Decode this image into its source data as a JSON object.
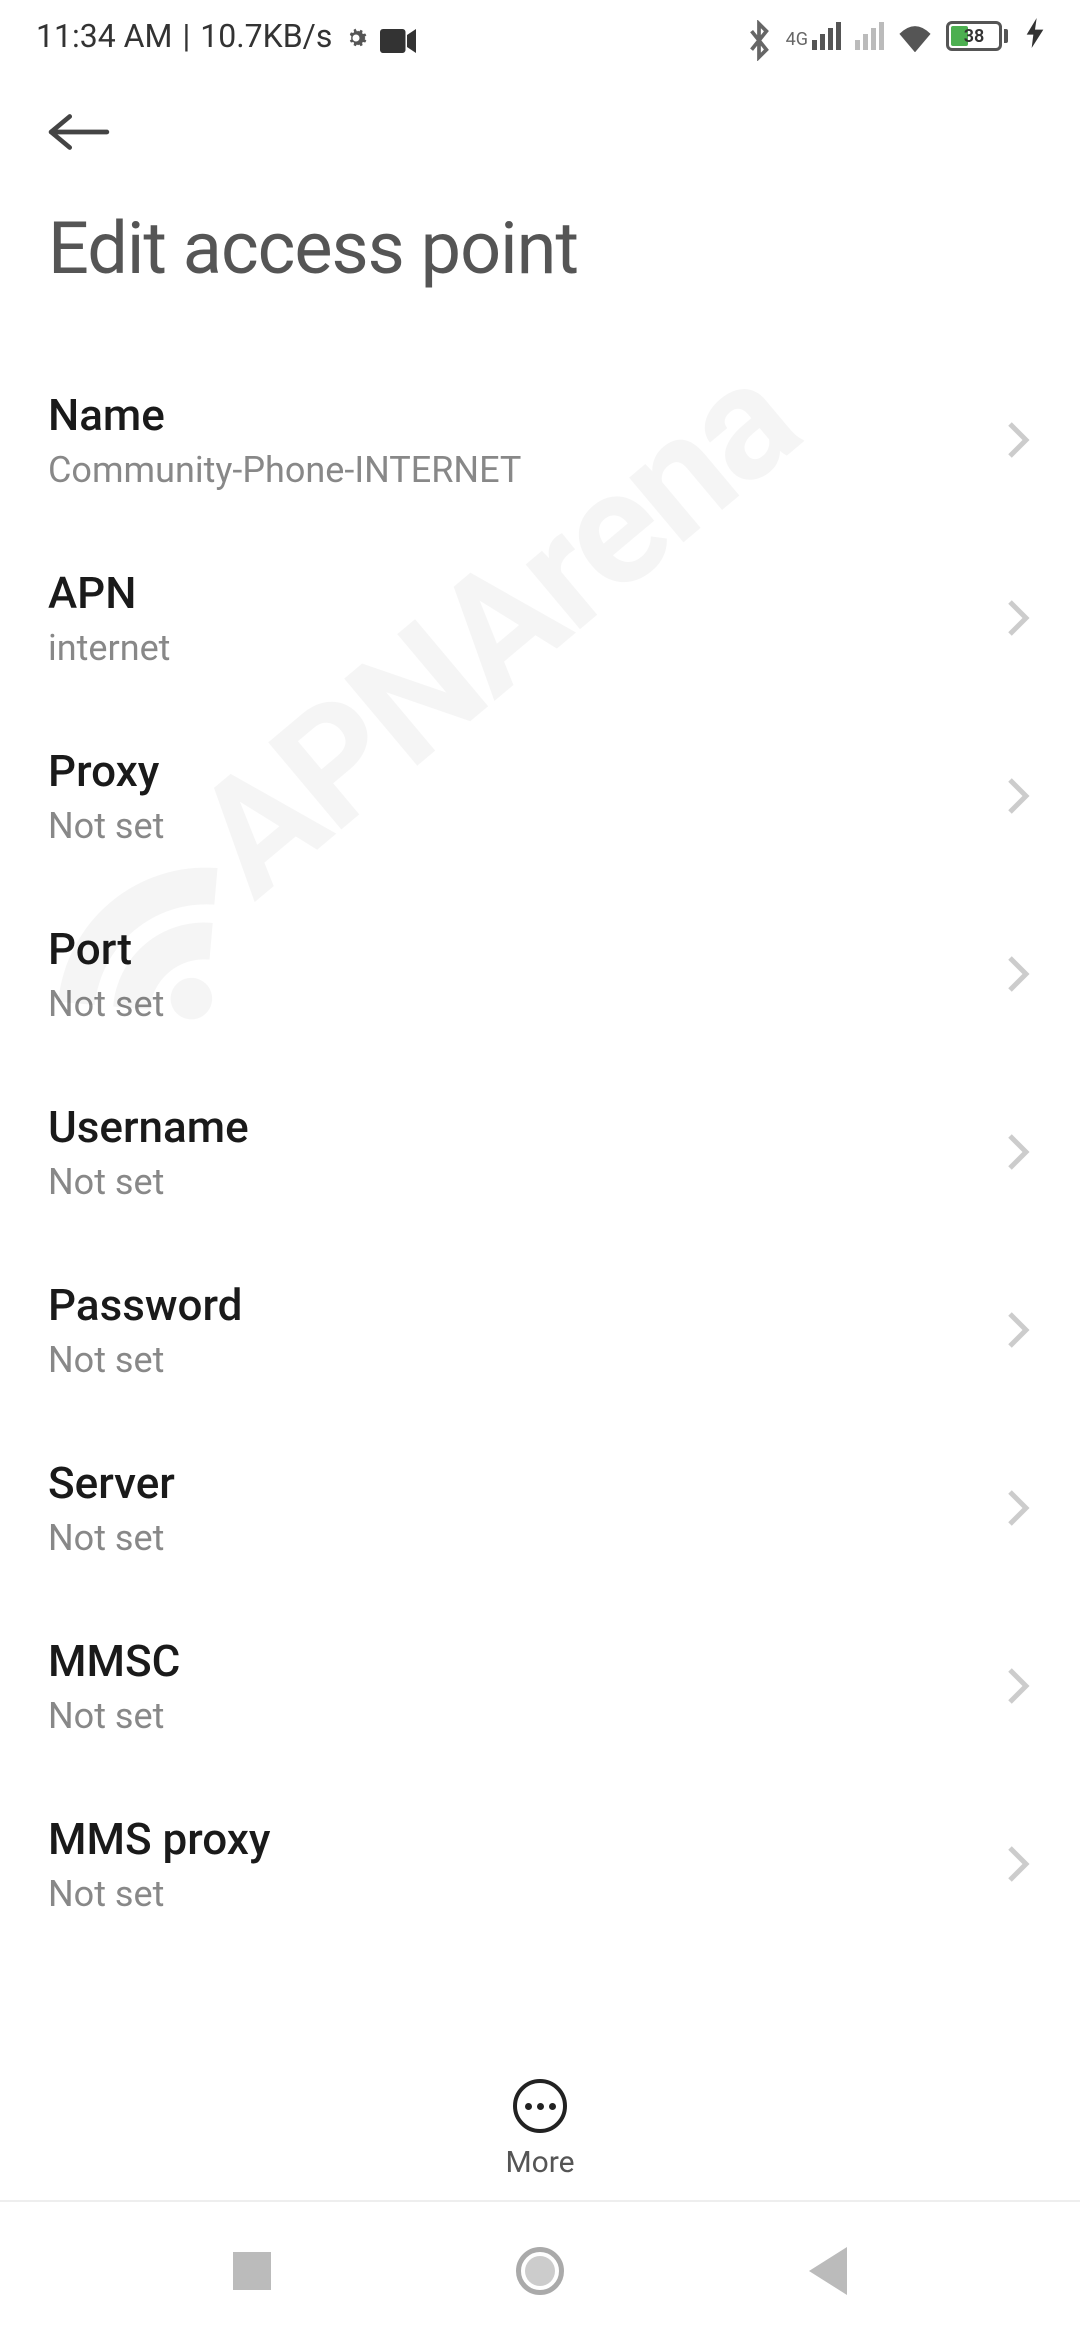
{
  "status": {
    "time": "11:34 AM",
    "speed": "10.7KB/s",
    "network_label": "4G",
    "battery_percent": "38"
  },
  "page": {
    "title": "Edit access point"
  },
  "settings": [
    {
      "label": "Name",
      "value": "Community-Phone-INTERNET"
    },
    {
      "label": "APN",
      "value": "internet"
    },
    {
      "label": "Proxy",
      "value": "Not set"
    },
    {
      "label": "Port",
      "value": "Not set"
    },
    {
      "label": "Username",
      "value": "Not set"
    },
    {
      "label": "Password",
      "value": "Not set"
    },
    {
      "label": "Server",
      "value": "Not set"
    },
    {
      "label": "MMSC",
      "value": "Not set"
    },
    {
      "label": "MMS proxy",
      "value": "Not set"
    }
  ],
  "bottom": {
    "more": "More"
  },
  "watermark": "APNArena"
}
